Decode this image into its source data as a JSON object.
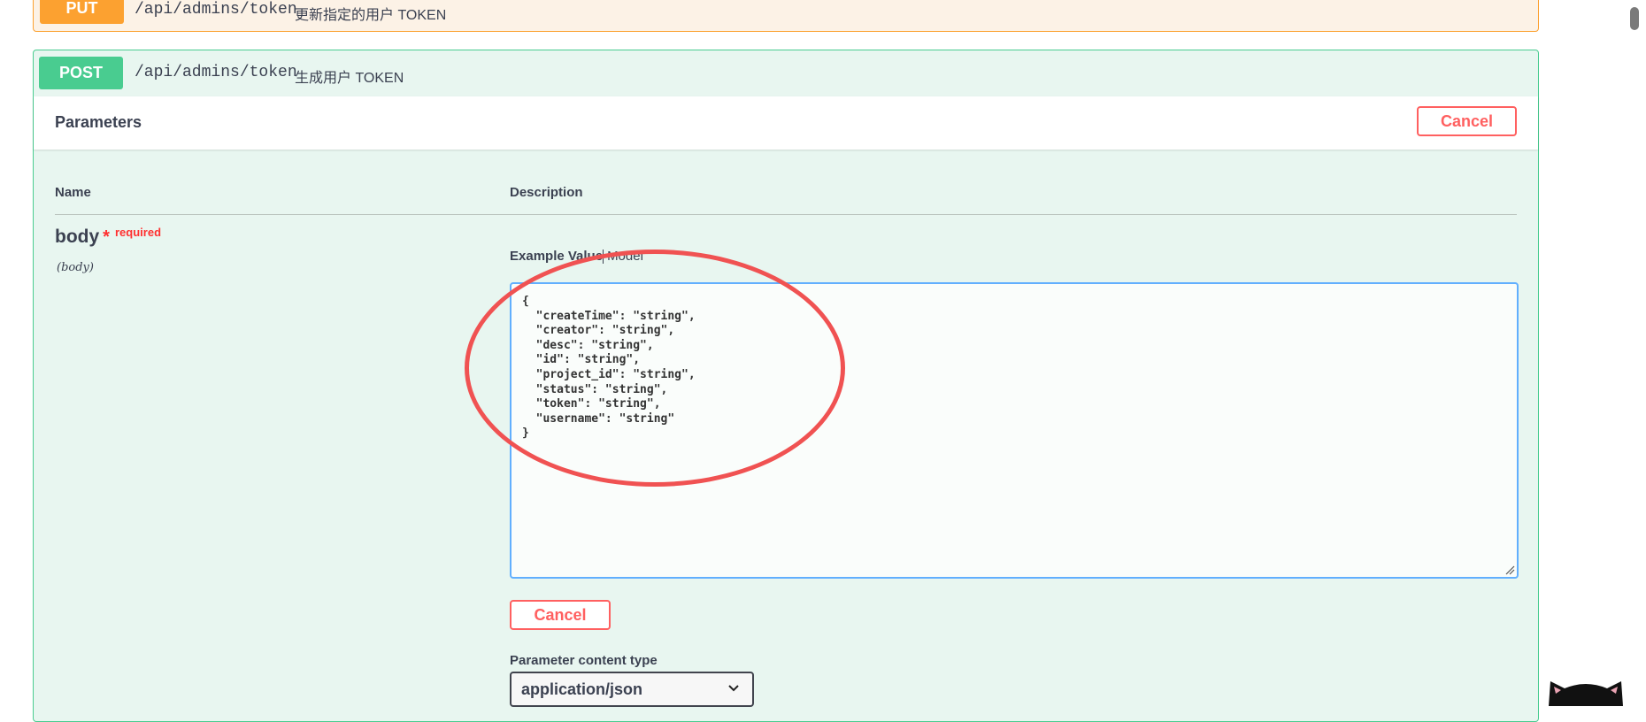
{
  "put_op": {
    "method": "PUT",
    "path": "/api/admins/token",
    "summary": "更新指定的用户 TOKEN"
  },
  "post_op": {
    "method": "POST",
    "path": "/api/admins/token",
    "summary": "生成用户 TOKEN",
    "section_title": "Parameters",
    "cancel_label": "Cancel",
    "columns": {
      "name": "Name",
      "description": "Description"
    },
    "param": {
      "name": "body",
      "required_star": "*",
      "required_label": "required",
      "in": "(body)"
    },
    "tabs": {
      "example": "Example Value",
      "model": "Model"
    },
    "body_lines": [
      "{",
      "  \"createTime\": \"string\",",
      "  \"creator\": \"string\",",
      "  \"desc\": \"string\",",
      "  \"id\": \"string\",",
      "  \"project_id\": \"string\",",
      "  \"status\": \"string\",",
      "  \"token\": \"string\",",
      "  \"username\": \"string\"",
      "}"
    ],
    "cancel_bottom_label": "Cancel",
    "content_type_label": "Parameter content type",
    "content_type_value": "application/json"
  },
  "colors": {
    "put": "#fca130",
    "post": "#49cc90",
    "cancel": "#ff6060",
    "annotation": "#f05252"
  },
  "icons": {
    "select": "chevron-down-icon",
    "resize": "resize-grip-icon"
  }
}
